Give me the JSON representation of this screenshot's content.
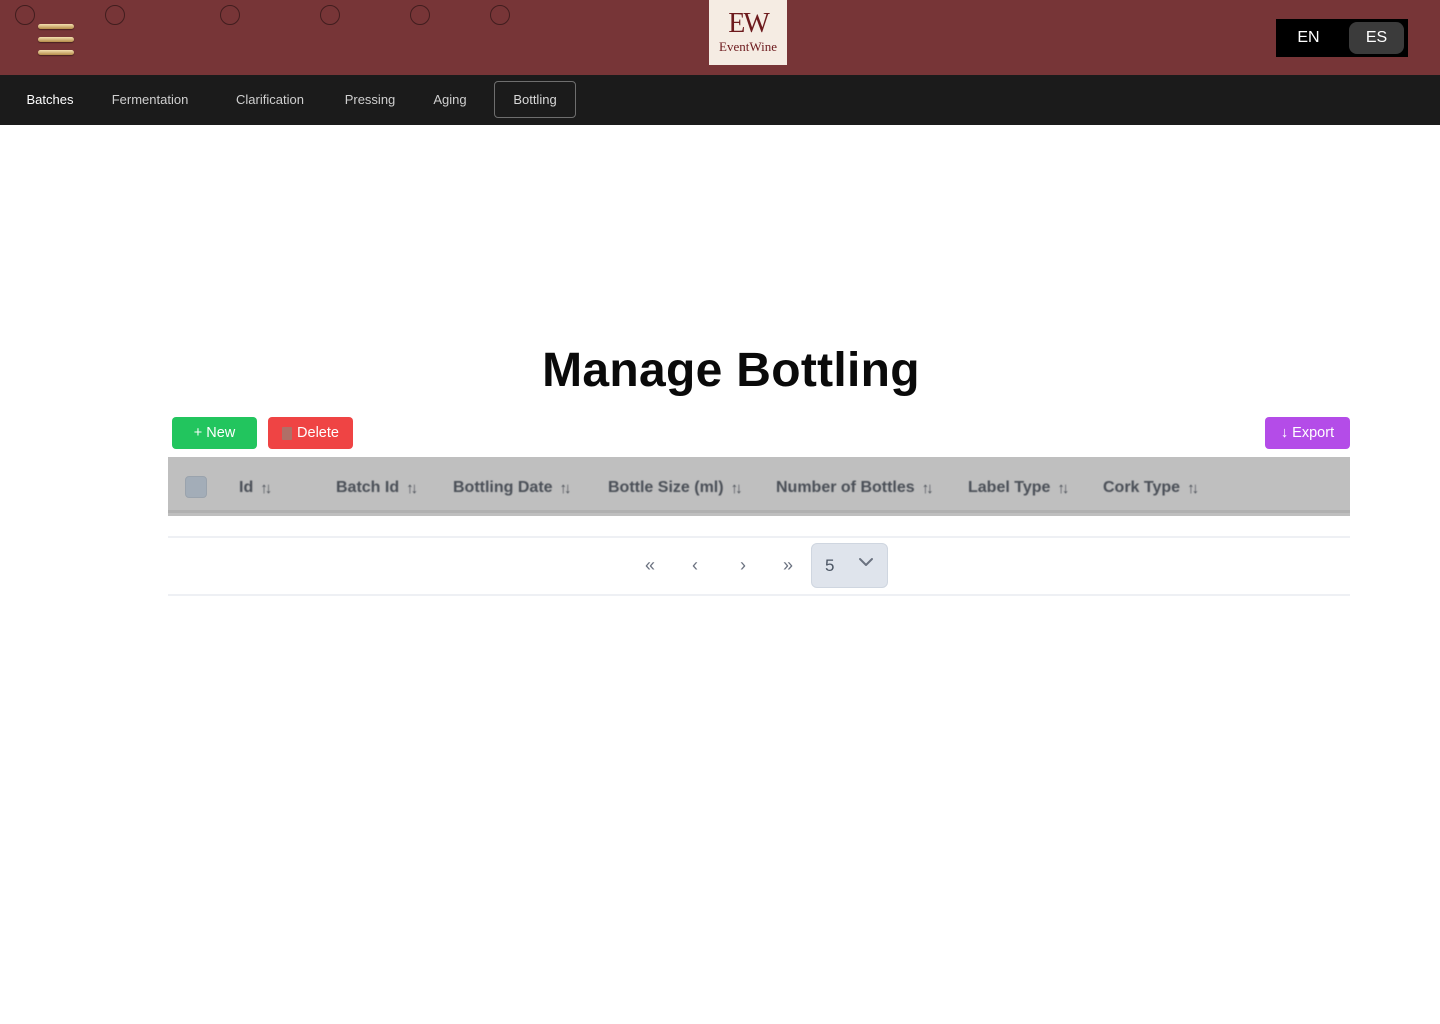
{
  "header": {
    "logo_mark": "EW",
    "logo_text": "EventWine",
    "languages": [
      "EN",
      "ES"
    ]
  },
  "nav": {
    "items": [
      "Batches",
      "Fermentation",
      "Clarification",
      "Pressing",
      "Aging",
      "Bottling"
    ],
    "active": "Bottling"
  },
  "main": {
    "title": "Manage Bottling",
    "new_label": "+ New",
    "delete_label": "Delete",
    "export_label": "↓ Export",
    "columns": [
      "Id",
      "Batch Id",
      "Bottling Date",
      "Bottle Size (ml)",
      "Number of Bottles",
      "Label Type",
      "Cork Type"
    ],
    "sort_glyph": "↑↓",
    "rows": []
  },
  "pagination": {
    "first": "«",
    "prev": "‹",
    "next": "›",
    "last": "»",
    "page_size": "5"
  },
  "colors": {
    "header_bg": "#773537",
    "nav_bg": "#1b1b1b",
    "new": "#22c55e",
    "delete": "#ef4444",
    "export": "#b44ce8"
  },
  "icons": {
    "menu": "hamburger-icon",
    "trash": "trash-icon",
    "sort": "sort-icon",
    "chevron": "chevron-down-icon"
  }
}
